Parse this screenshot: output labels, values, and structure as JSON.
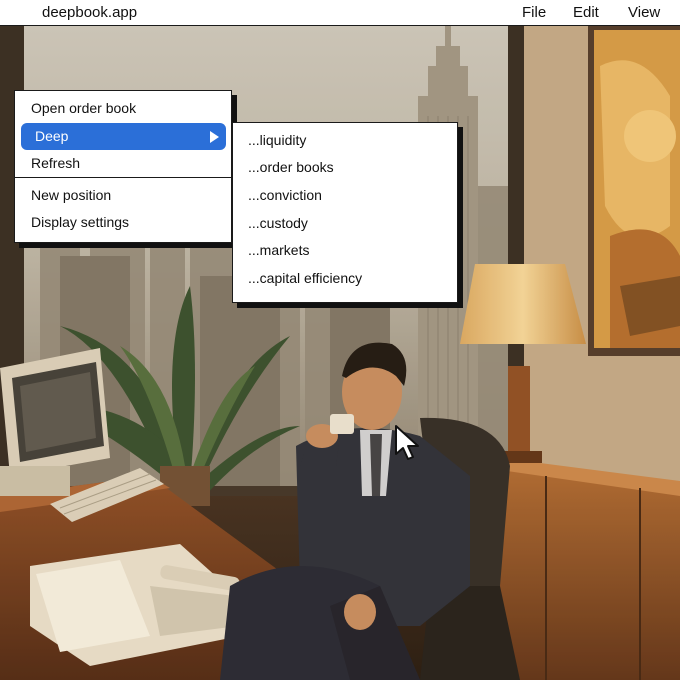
{
  "menubar": {
    "app_name": "deepbook.app",
    "menus": [
      "File",
      "Edit",
      "View"
    ]
  },
  "context_menu": {
    "items": [
      {
        "label": "Open order book"
      },
      {
        "label": "Deep",
        "active": true,
        "has_submenu": true
      },
      {
        "label": "Refresh"
      },
      {
        "label": "New position"
      },
      {
        "label": "Display settings"
      }
    ]
  },
  "submenu": {
    "items": [
      {
        "label": "...liquidity"
      },
      {
        "label": "...order books"
      },
      {
        "label": "...conviction"
      },
      {
        "label": "...custody"
      },
      {
        "label": "...markets"
      },
      {
        "label": "...capital efficiency"
      }
    ]
  },
  "colors": {
    "highlight": "#2b6fd8",
    "menubar_bg": "#ffffff",
    "border": "#1a1a1a"
  },
  "icons": {
    "submenu_indicator": "triangle-right-icon",
    "pointer": "mouse-cursor-icon"
  }
}
